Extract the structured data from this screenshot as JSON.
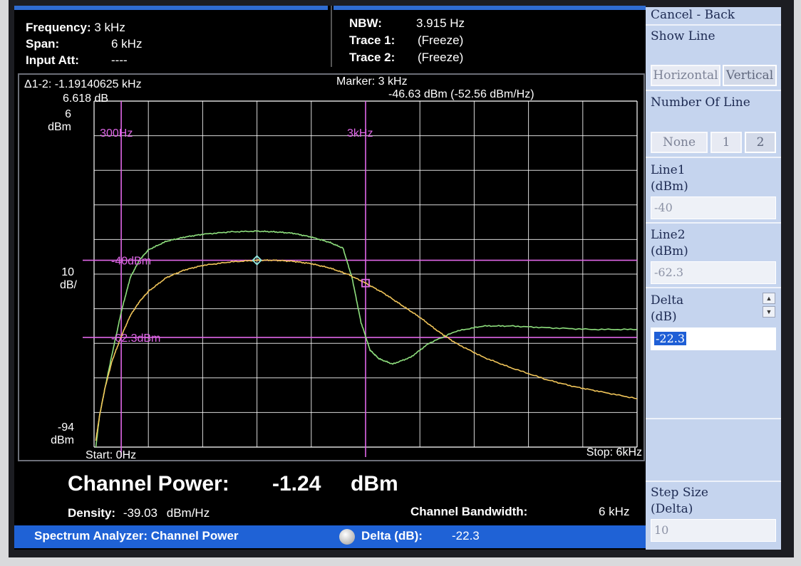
{
  "header": {
    "frequency_label": "Frequency:",
    "frequency_value": "3 kHz",
    "span_label": "Span:",
    "span_value": "6 kHz",
    "input_att_label": "Input Att:",
    "input_att_value": "----",
    "nbw_label": "NBW:",
    "nbw_value": "3.915 Hz",
    "trace1_label": "Trace 1:",
    "trace1_value": "(Freeze)",
    "trace2_label": "Trace 2:",
    "trace2_value": "(Freeze)"
  },
  "delta_marker": {
    "label": "Δ1-2: -1.19140625 kHz",
    "level": "6.618 dB"
  },
  "marker": {
    "label": "Marker: 3 kHz",
    "level": "-46.63 dBm (-52.56 dBm/Hz)"
  },
  "scale": {
    "top_value": "6",
    "top_unit": "dBm",
    "div_value": "10",
    "div_unit": "dB/",
    "bottom_value": "-94",
    "bottom_unit": "dBm"
  },
  "chart_data": {
    "type": "line",
    "xlim": [
      0,
      6000
    ],
    "ylim": [
      -94,
      6
    ],
    "x_unit": "Hz",
    "y_unit": "dBm",
    "grid": true,
    "start_label": "Start: 0Hz",
    "stop_label": "Stop: 6kHz",
    "vertical_markers": [
      {
        "label": "300Hz",
        "x": 300
      },
      {
        "label": "3kHz",
        "x": 3000
      }
    ],
    "horizontal_lines": [
      {
        "label": "-40dBm",
        "y": -40
      },
      {
        "label": "-62.3dBm",
        "y": -62.3
      }
    ],
    "series": [
      {
        "color": "#8fe07e",
        "x": [
          20,
          60,
          120,
          200,
          300,
          400,
          500,
          600,
          800,
          1000,
          1200,
          1500,
          1800,
          2000,
          2200,
          2400,
          2600,
          2750,
          2850,
          2950,
          3050,
          3150,
          3300,
          3500,
          3700,
          4000,
          4300,
          4600,
          5000,
          5500,
          6000
        ],
        "y": [
          -94,
          -85,
          -77,
          -67,
          -55,
          -45,
          -40,
          -37,
          -34.5,
          -33.3,
          -32.5,
          -31.8,
          -31.6,
          -31.8,
          -32.2,
          -33.3,
          -34.8,
          -36.5,
          -45,
          -58,
          -66,
          -68.5,
          -70,
          -68,
          -64,
          -60.5,
          -59,
          -59,
          -59.5,
          -60,
          -60
        ]
      },
      {
        "color": "#f2c65a",
        "x": [
          20,
          60,
          120,
          200,
          300,
          400,
          500,
          600,
          800,
          1000,
          1200,
          1500,
          1800,
          2000,
          2200,
          2400,
          2600,
          2800,
          3000,
          3200,
          3400,
          3600,
          3800,
          4000,
          4300,
          4600,
          5000,
          5300,
          5600,
          6000
        ],
        "y": [
          -92,
          -85,
          -77,
          -69,
          -62,
          -56,
          -52,
          -49,
          -45,
          -42.8,
          -41.5,
          -40.5,
          -40,
          -40,
          -40.3,
          -41,
          -42.2,
          -44,
          -46.6,
          -49.5,
          -53,
          -56.5,
          -60.5,
          -64,
          -68,
          -71,
          -74.5,
          -76.5,
          -78,
          -80
        ]
      }
    ],
    "markers": [
      {
        "shape": "diamond",
        "x": 1800,
        "y": -40
      },
      {
        "shape": "square",
        "x": 3000,
        "y": -46.6
      }
    ]
  },
  "bottom": {
    "channel_power_label": "Channel Power:",
    "channel_power_value": "-1.24",
    "channel_power_unit": "dBm",
    "density_label": "Density:",
    "density_value": "-39.03",
    "density_unit": "dBm/Hz",
    "bandwidth_label": "Channel Bandwidth:",
    "bandwidth_value": "6 kHz"
  },
  "statusbar": {
    "title": "Spectrum Analyzer: Channel Power",
    "delta_label": "Delta (dB):",
    "delta_value": "-22.3"
  },
  "panel": {
    "cancel_back": "Cancel - Back",
    "show_line": "Show Line",
    "horizontal": "Horizontal",
    "vertical": "Vertical",
    "number_of_line": "Number Of Line",
    "none": "None",
    "one": "1",
    "two": "2",
    "line1_label": "Line1",
    "line1_unit": "(dBm)",
    "line1_value": "-40",
    "line2_label": "Line2",
    "line2_unit": "(dBm)",
    "line2_value": "-62.3",
    "delta_label": "Delta",
    "delta_unit": "(dB)",
    "delta_value": "-22.3",
    "step_label": "Step Size",
    "step_unit": "(Delta)",
    "step_value": "10"
  },
  "colors": {
    "grid": "#ffffff",
    "marker_lines": "#e066e8",
    "screen_bg": "#000000",
    "status_bar": "#1f62d6",
    "panel_bg": "#c5d4ee"
  }
}
